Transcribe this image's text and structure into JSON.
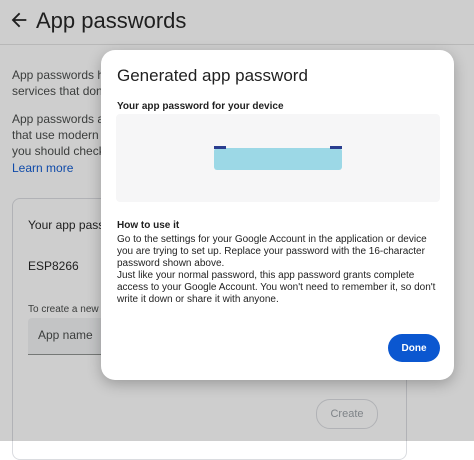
{
  "header": {
    "title": "App passwords",
    "back_icon": "arrow-back-icon"
  },
  "background": {
    "intro_line1": "App passwords help",
    "intro_line2": "services that don't",
    "intro_line3": "App passwords are",
    "intro_line4": "that use modern se",
    "intro_line5": "you should check to",
    "learn_more": "Learn more",
    "card_title": "Your app passw",
    "device_name": "ESP8266",
    "create_text": "To create a new ap",
    "app_name_placeholder": "App name",
    "create_button": "Create"
  },
  "dialog": {
    "title": "Generated app password",
    "subtitle": "Your app password for your device",
    "how_title": "How to use it",
    "para1": "Go to the settings for your Google Account in the application or device you are trying to set up. Replace your password with the 16-character password shown above.",
    "para2": "Just like your normal password, this app password grants complete access to your Google Account. You won't need to remember it, so don't write it down or share it with anyone.",
    "done_label": "Done"
  },
  "colors": {
    "accent": "#0b57d0",
    "redaction": "#9cd8e6"
  }
}
